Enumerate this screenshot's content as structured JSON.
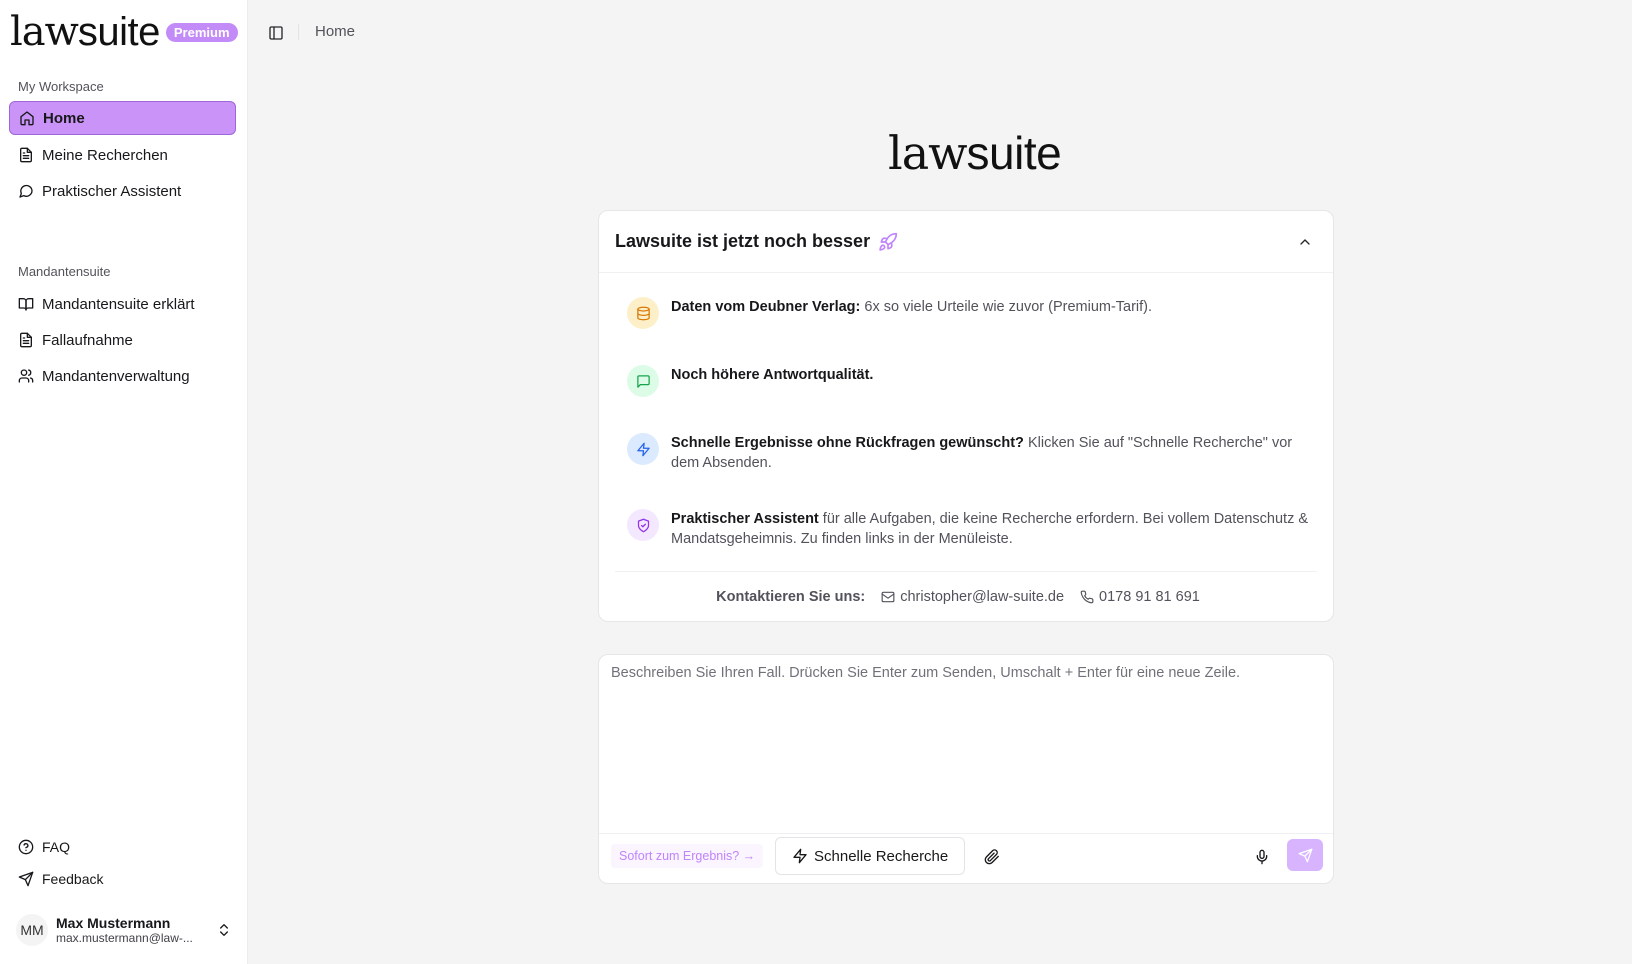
{
  "brand": {
    "logo_bold": "law",
    "logo_thin": "suite",
    "badge": "Premium"
  },
  "sidebar": {
    "workspace_label": "My Workspace",
    "workspace_items": [
      {
        "label": "Home",
        "icon": "home-icon",
        "active": true
      },
      {
        "label": "Meine Recherchen",
        "icon": "document-icon"
      },
      {
        "label": "Praktischer Assistent",
        "icon": "chat-icon"
      }
    ],
    "mandant_label": "Mandantensuite",
    "mandant_items": [
      {
        "label": "Mandantensuite erklärt",
        "icon": "book-open-icon"
      },
      {
        "label": "Fallaufnahme",
        "icon": "document-icon"
      },
      {
        "label": "Mandantenverwaltung",
        "icon": "users-icon"
      }
    ],
    "footer_items": [
      {
        "label": "FAQ",
        "icon": "help-circle-icon"
      },
      {
        "label": "Feedback",
        "icon": "send-icon"
      }
    ],
    "user": {
      "initials": "MM",
      "name": "Max Mustermann",
      "email": "max.mustermann@law-..."
    }
  },
  "topbar": {
    "breadcrumb": "Home"
  },
  "center_logo": {
    "bold": "law",
    "thin": "suite"
  },
  "announcement": {
    "title": "Lawsuite ist jetzt noch besser",
    "features": [
      {
        "bold": "Daten vom Deubner Verlag:",
        "text": " 6x so viele Urteile wie zuvor (Premium-Tarif).",
        "icon": "database-icon",
        "bg": "#fdf0c8",
        "fg": "#d97706"
      },
      {
        "bold": "Noch höhere Antwortqualität.",
        "text": "",
        "icon": "message-square-icon",
        "bg": "#dcfce7",
        "fg": "#16a34a"
      },
      {
        "bold": "Schnelle Ergebnisse ohne Rückfragen gewünscht?",
        "text": " Klicken Sie auf \"Schnelle Recherche\" vor dem Absenden.",
        "icon": "zap-icon",
        "bg": "#dbeafe",
        "fg": "#2563eb"
      },
      {
        "bold": "Praktischer Assistent",
        "text": " für alle Aufgaben, die keine Recherche erfordern. Bei vollem Datenschutz & Mandatsgeheimnis. Zu finden links in der Menüleiste.",
        "icon": "shield-check-icon",
        "bg": "#f3e8ff",
        "fg": "#9333ea"
      }
    ],
    "contact_label": "Kontaktieren Sie uns:",
    "email": "christopher@law-suite.de",
    "phone": "0178 91 81 691"
  },
  "composer": {
    "placeholder": "Beschreiben Sie Ihren Fall. Drücken Sie Enter zum Senden, Umschalt + Enter für eine neue Zeile.",
    "hint": "Sofort zum Ergebnis? →",
    "quick_label": "Schnelle Recherche"
  },
  "colors": {
    "accent": "#c993f7",
    "accent_border": "#9f66d9",
    "send_bg": "#d8b4fe"
  }
}
